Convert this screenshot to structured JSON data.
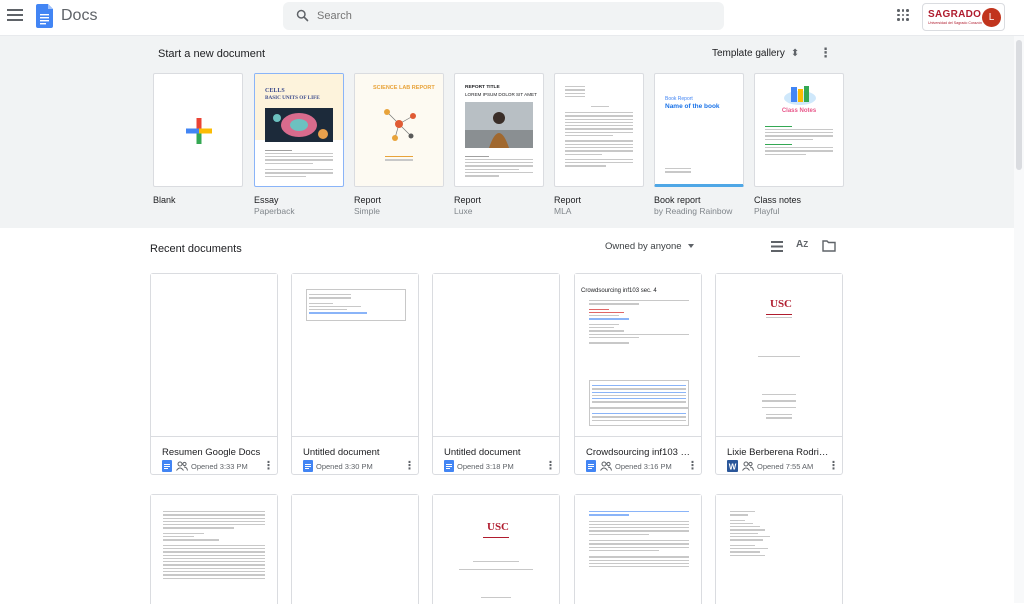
{
  "app": {
    "title": "Docs"
  },
  "search": {
    "placeholder": "Search"
  },
  "account": {
    "brand_name": "SAGRADO",
    "brand_tagline": "Universidad del Sagrado Corazón",
    "avatar_initial": "L"
  },
  "templates": {
    "heading": "Start a new document",
    "gallery_label": "Template gallery",
    "items": [
      {
        "name": "Blank",
        "sub": ""
      },
      {
        "name": "Essay",
        "sub": "Paperback"
      },
      {
        "name": "Report",
        "sub": "Simple"
      },
      {
        "name": "Report",
        "sub": "Luxe"
      },
      {
        "name": "Report",
        "sub": "MLA"
      },
      {
        "name": "Book report",
        "sub": "by Reading Rainbow"
      },
      {
        "name": "Class notes",
        "sub": "Playful"
      }
    ],
    "essay_thumb": {
      "line1": "CELLS",
      "line2": "BASIC UNITS OF LIFE"
    },
    "simple_thumb": {
      "title": "SCIENCE LAB REPORT"
    },
    "luxe_thumb": {
      "title": "REPORT TITLE",
      "sub": "LOREM IPSUM DOLOR SIT AMET"
    },
    "book_thumb": {
      "label": "Book Report",
      "title": "Name of the book"
    },
    "notes_thumb": {
      "title": "Class Notes"
    }
  },
  "recent": {
    "heading": "Recent documents",
    "filter_label": "Owned by anyone",
    "docs": [
      {
        "title": "Resumen Google Docs",
        "opened": "Opened 3:33 PM",
        "icon": "docs",
        "shared": true
      },
      {
        "title": "Untitled document",
        "opened": "Opened 3:30 PM",
        "icon": "docs",
        "shared": false
      },
      {
        "title": "Untitled document",
        "opened": "Opened 3:18 PM",
        "icon": "docs",
        "shared": false
      },
      {
        "title": "Crowdsourcing inf103 se...",
        "opened": "Opened 3:16 PM",
        "icon": "docs",
        "shared": true
      },
      {
        "title": "Lixie Berberena Rodrigue...",
        "opened": "Opened 7:55 AM",
        "icon": "word",
        "shared": true
      }
    ],
    "crowd_preview_title": "Crowdsourcing inf103 sec. 4"
  },
  "colors": {
    "docs_blue": "#4285f4",
    "word_blue": "#2b579a",
    "brand_red": "#b01c2e",
    "avatar": "#c1341d",
    "header_bg": "#f1f3f4"
  }
}
